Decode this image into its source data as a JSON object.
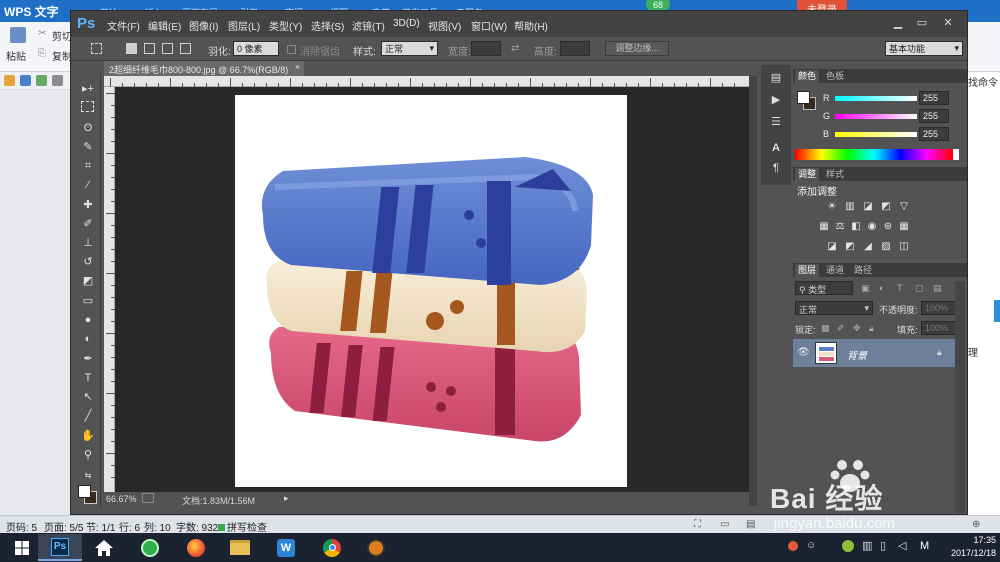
{
  "wps": {
    "app_name": "WPS 文字",
    "ribbon_tabs": [
      "开始",
      "插入",
      "页面布局",
      "引用",
      "审阅",
      "视图",
      "章节",
      "开发工具",
      "云服务"
    ],
    "login_button": "未登录",
    "badge_count": "68",
    "ribbon_items": {
      "paste": "粘贴",
      "cut": "剪切",
      "copy": "复制"
    },
    "right_pane_texts": [
      "找命令",
      "理"
    ],
    "status": {
      "page": "页码: 5",
      "pages": "页面: 5/5",
      "section": "节: 1/1",
      "row": "行: 6",
      "col": "列: 10",
      "words": "字数: 932",
      "spellcheck": "拼写检查"
    }
  },
  "photoshop": {
    "logo": "Ps",
    "menu": [
      "文件(F)",
      "编辑(E)",
      "图像(I)",
      "图层(L)",
      "类型(Y)",
      "选择(S)",
      "滤镜(T)",
      "3D(D)",
      "视图(V)",
      "窗口(W)",
      "帮助(H)"
    ],
    "options": {
      "feather_label": "羽化:",
      "feather_value": "0 像素",
      "antialias_label": "消除锯齿",
      "style_label": "样式:",
      "style_value": "正常",
      "width_label": "宽度:",
      "height_label": "高度:",
      "refine_edge": "调整边缘...",
      "workspace": "基本功能"
    },
    "document_tab": "2超细纤维毛巾800-800.jpg @ 66.7%(RGB/8)",
    "document_tab_close": "×",
    "status": {
      "zoom": "66.67%",
      "doc_size": "文档:1.83M/1.56M"
    },
    "color_panel": {
      "tabs": [
        "颜色",
        "色板"
      ],
      "channels": [
        {
          "label": "R",
          "value": "255"
        },
        {
          "label": "G",
          "value": "255"
        },
        {
          "label": "B",
          "value": "255"
        }
      ]
    },
    "adjust_panel": {
      "tabs": [
        "调整",
        "样式"
      ],
      "title": "添加调整"
    },
    "layers_panel": {
      "tabs": [
        "图层",
        "通道",
        "路径"
      ],
      "filter_kind": "类型",
      "blend_mode": "正常",
      "opacity_label": "不透明度:",
      "opacity_value": "100%",
      "lock_label": "锁定:",
      "fill_label": "填充:",
      "fill_value": "100%",
      "layer_name": "背景"
    }
  },
  "taskbar": {
    "time": "17:35",
    "date": "2017/12/18",
    "ime": "M"
  },
  "watermark": {
    "brand": "Bai 经验",
    "url": "jingyan.baidu.com"
  }
}
